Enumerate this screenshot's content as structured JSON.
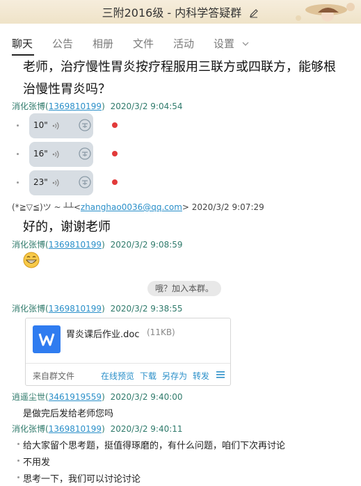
{
  "window": {
    "title": "三附2016级 - 内科学答疑群"
  },
  "tabs": [
    "聊天",
    "公告",
    "相册",
    "文件",
    "活动",
    "设置"
  ],
  "messages": {
    "m0_line1": "老师，治疗慢性胃炎按疗程服用三联方或四联方，能够根",
    "m0_line2": "治慢性胃炎吗？",
    "s1": {
      "name": "消化张博",
      "qq": "1369810199",
      "time": "2020/3/2 9:04:54"
    },
    "voices": [
      "10\"",
      "16\"",
      "23\""
    ],
    "s2": {
      "name": "(*≧▽≦)ツ ~ ┴┴",
      "email": "zhanghao0036@qq.com",
      "time": "2020/3/2 9:07:29"
    },
    "m2": "好的，谢谢老师",
    "s3": {
      "name": "消化张博",
      "qq": "1369810199",
      "time": "2020/3/2 9:08:59"
    },
    "system_note": "哦？加入本群。",
    "s4": {
      "name": "消化张博",
      "qq": "1369810199",
      "time": "2020/3/2 9:38:55"
    },
    "file": {
      "name": "胃炎课后作业.doc",
      "size": "(11KB)",
      "from": "来自群文件",
      "actions": [
        "在线预览",
        "下载",
        "另存为",
        "转发"
      ]
    },
    "s5": {
      "name": "逍遥尘世",
      "qq": "3461919559",
      "time": "2020/3/2 9:40:00"
    },
    "m5": "是做完后发给老师您吗",
    "s6": {
      "name": "消化张博",
      "qq": "1369810199",
      "time": "2020/3/2 9:40:11"
    },
    "m6": [
      "给大家留个思考题，挺值得琢磨的，有什么问题，咱们下次再讨论",
      "不用发",
      "思考一下，我们可以讨论讨论"
    ]
  },
  "colors": {
    "accent_link": "#2a8fc9",
    "sender_green": "#2f7a6b",
    "unread_red": "#e23a3a",
    "doc_blue": "#2f7cf0"
  }
}
